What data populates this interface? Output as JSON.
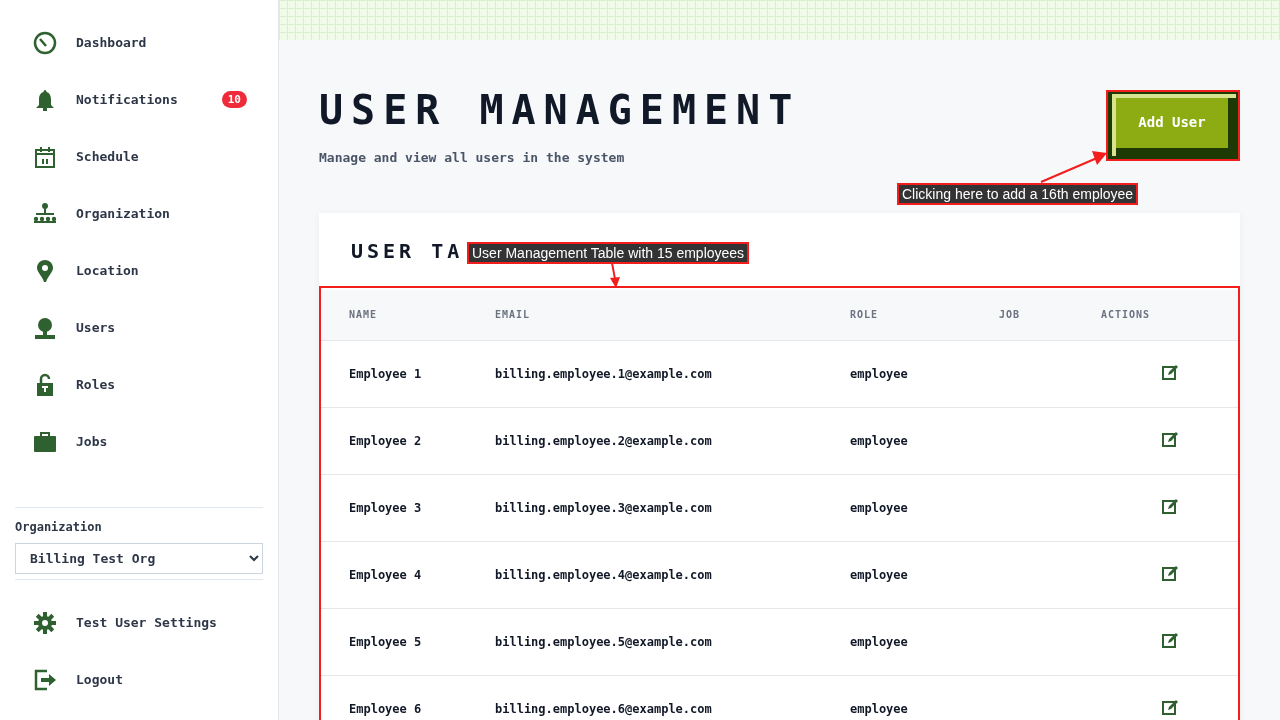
{
  "sidebar": {
    "items": [
      {
        "label": "Dashboard"
      },
      {
        "label": "Notifications",
        "badge": "10"
      },
      {
        "label": "Schedule"
      },
      {
        "label": "Organization"
      },
      {
        "label": "Location"
      },
      {
        "label": "Users"
      },
      {
        "label": "Roles"
      },
      {
        "label": "Jobs"
      }
    ],
    "organization": {
      "label": "Organization",
      "value": "Billing Test Org"
    },
    "footer_items": [
      {
        "label": "Test User Settings"
      },
      {
        "label": "Logout"
      }
    ]
  },
  "header": {
    "title": "USER MANAGEMENT",
    "subtitle": "Manage and view all users in the system",
    "add_button": "Add User"
  },
  "table": {
    "title": "USER TA",
    "columns": [
      "NAME",
      "EMAIL",
      "ROLE",
      "JOB",
      "ACTIONS"
    ],
    "rows": [
      {
        "name": "Employee 1",
        "email": "billing.employee.1@example.com",
        "role": "employee"
      },
      {
        "name": "Employee 2",
        "email": "billing.employee.2@example.com",
        "role": "employee"
      },
      {
        "name": "Employee 3",
        "email": "billing.employee.3@example.com",
        "role": "employee"
      },
      {
        "name": "Employee 4",
        "email": "billing.employee.4@example.com",
        "role": "employee"
      },
      {
        "name": "Employee 5",
        "email": "billing.employee.5@example.com",
        "role": "employee"
      },
      {
        "name": "Employee 6",
        "email": "billing.employee.6@example.com",
        "role": "employee"
      }
    ]
  },
  "annotations": [
    {
      "kind": "table",
      "text": "User Management Table with 15 employees"
    },
    {
      "kind": "button",
      "text": "Clicking here to add a 16th employee"
    }
  ]
}
